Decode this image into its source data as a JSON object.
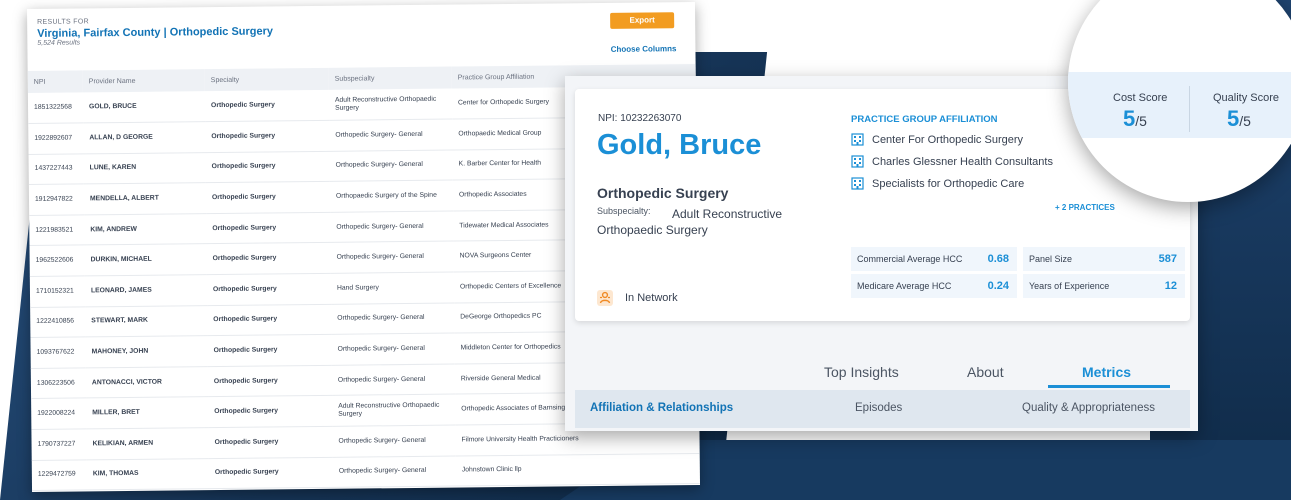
{
  "results": {
    "results_for_label": "RESULTS FOR",
    "title": "Virginia, Fairfax County | Orthopedic Surgery",
    "count": "5,524 Results",
    "export_label": "Export",
    "choose_columns_label": "Choose Columns",
    "columns": [
      "NPI",
      "Provider Name",
      "Specialty",
      "Subspecialty",
      "Practice Group Affiliation"
    ],
    "rows": [
      {
        "npi": "1851322568",
        "name": "GOLD, BRUCE",
        "specialty": "Orthopedic Surgery",
        "subspecialty": "Adult Reconstructive Orthopaedic Surgery",
        "practice": "Center for Orthopedic Surgery"
      },
      {
        "npi": "1922892607",
        "name": "ALLAN, D GEORGE",
        "specialty": "Orthopedic Surgery",
        "subspecialty": "Orthopedic Surgery- General",
        "practice": "Orthopaedic Medical Group"
      },
      {
        "npi": "1437227443",
        "name": "LUNE, KAREN",
        "specialty": "Orthopedic Surgery",
        "subspecialty": "Orthopedic Surgery- General",
        "practice": "K. Barber Center for Health"
      },
      {
        "npi": "1912947822",
        "name": "MENDELLA, ALBERT",
        "specialty": "Orthopedic Surgery",
        "subspecialty": "Orthopaedic Surgery of the Spine",
        "practice": "Orthopedic Associates"
      },
      {
        "npi": "1221983521",
        "name": "KIM, ANDREW",
        "specialty": "Orthopedic Surgery",
        "subspecialty": "Orthopedic Surgery- General",
        "practice": "Tidewater Medical Associates"
      },
      {
        "npi": "1962522606",
        "name": "DURKIN, MICHAEL",
        "specialty": "Orthopedic Surgery",
        "subspecialty": "Orthopedic Surgery- General",
        "practice": "NOVA Surgeons Center"
      },
      {
        "npi": "1710152321",
        "name": "LEONARD, JAMES",
        "specialty": "Orthopedic Surgery",
        "subspecialty": "Hand Surgery",
        "practice": "Orthopedic Centers of Excellence"
      },
      {
        "npi": "1222410856",
        "name": "STEWART, MARK",
        "specialty": "Orthopedic Surgery",
        "subspecialty": "Orthopedic Surgery- General",
        "practice": "DeGeorge Orthopedics PC"
      },
      {
        "npi": "1093767622",
        "name": "MAHONEY, JOHN",
        "specialty": "Orthopedic Surgery",
        "subspecialty": "Orthopedic Surgery- General",
        "practice": "Middleton Center for Orthopedics"
      },
      {
        "npi": "1306223506",
        "name": "ANTONACCI, VICTOR",
        "specialty": "Orthopedic Surgery",
        "subspecialty": "Orthopedic Surgery- General",
        "practice": "Riverside General Medical"
      },
      {
        "npi": "1922008224",
        "name": "MILLER, BRET",
        "specialty": "Orthopedic Surgery",
        "subspecialty": "Adult Reconstructive Orthopaedic Surgery",
        "practice": "Orthopedic Associates of Barnsington"
      },
      {
        "npi": "1790737227",
        "name": "KELIKIAN, ARMEN",
        "specialty": "Orthopedic Surgery",
        "subspecialty": "Orthopedic Surgery- General",
        "practice": "Filmore University Health Practicioners"
      },
      {
        "npi": "1229472759",
        "name": "KIM, THOMAS",
        "specialty": "Orthopedic Surgery",
        "subspecialty": "Orthopedic Surgery- General",
        "practice": "Johnstown Clinic llp"
      }
    ]
  },
  "provider": {
    "npi_label": "NPI:",
    "npi": "10232263070",
    "name": "Gold, Bruce",
    "specialty": "Orthopedic Surgery",
    "subspecialty_label": "Subspecialty:",
    "subspecialty": "Adult Reconstructive Orthopaedic Surgery",
    "network_status": "In Network",
    "practice_group_title": "PRACTICE GROUP AFFILIATION",
    "practices": [
      "Center For Orthopedic Surgery",
      "Charles Glessner Health Consultants",
      "Specialists for Orthopedic Care"
    ],
    "more_practices": "+ 2 PRACTICES",
    "metrics": {
      "commercial_hcc_label": "Commercial Average HCC",
      "commercial_hcc": "0.68",
      "medicare_hcc_label": "Medicare Average HCC",
      "medicare_hcc": "0.24",
      "panel_size_label": "Panel Size",
      "panel_size": "587",
      "experience_label": "Years of Experience",
      "experience": "12"
    },
    "scores": {
      "cost_label": "Cost Score",
      "cost_value": "5",
      "cost_denominator": "/5",
      "quality_label": "Quality Score",
      "quality_value": "5",
      "quality_denominator": "/5"
    },
    "tabs": [
      "Top Insights",
      "About",
      "Metrics"
    ],
    "active_tab": "Metrics",
    "subtabs": [
      "Affiliation & Relationships",
      "Episodes",
      "Quality & Appropriateness"
    ],
    "active_subtab": "Affiliation & Relationships"
  },
  "colors": {
    "accent": "#1b8fd6",
    "title_blue": "#1273b5",
    "export_orange": "#f29c21",
    "navy_background": "#163456",
    "network_icon": "#f08a24"
  },
  "icons": {
    "practice": "building-icon",
    "network": "network-person-icon"
  }
}
